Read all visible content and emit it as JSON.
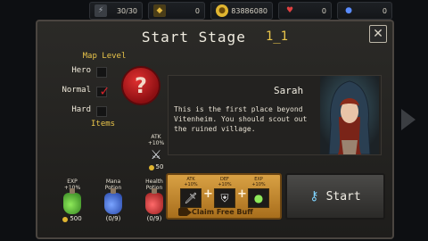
{
  "resources": {
    "energy": "30/30",
    "gems": "0",
    "gold": "83886080",
    "health_potions": "0",
    "mana_potions": "0"
  },
  "modal": {
    "title": "Start Stage",
    "stage_code": "1_1",
    "close_label": "✕"
  },
  "map_level": {
    "title": "Map Level",
    "options": [
      "Hero",
      "Normal",
      "Hard"
    ],
    "selected": "Normal",
    "mystery_glyph": "?"
  },
  "items": {
    "title": "Items",
    "list": [
      {
        "name_line1": "EXP",
        "name_line2": "+10%",
        "price": "500"
      },
      {
        "name_line1": "Mana",
        "name_line2": "Potion",
        "count": "(0/9)"
      },
      {
        "name_line1": "Health",
        "name_line2": "Potion",
        "count": "(0/9)"
      }
    ],
    "atk": {
      "line1": "ATK",
      "line2": "+10%",
      "price": "50"
    }
  },
  "character": {
    "name": "Sarah",
    "description": "This is the first place beyond Vitenheim. You should scout out the ruined village."
  },
  "buffs": {
    "list": [
      {
        "line1": "ATK",
        "line2": "+10%"
      },
      {
        "line1": "DEF",
        "line2": "+10%"
      },
      {
        "line1": "EXP",
        "line2": "+10%"
      }
    ],
    "claim_label": "Claim Free Buff"
  },
  "start_button": {
    "label": "Start"
  },
  "colors": {
    "accent_gold": "#e8c44a",
    "check_red": "#d8232a",
    "buff_orange": "#d9a144"
  }
}
